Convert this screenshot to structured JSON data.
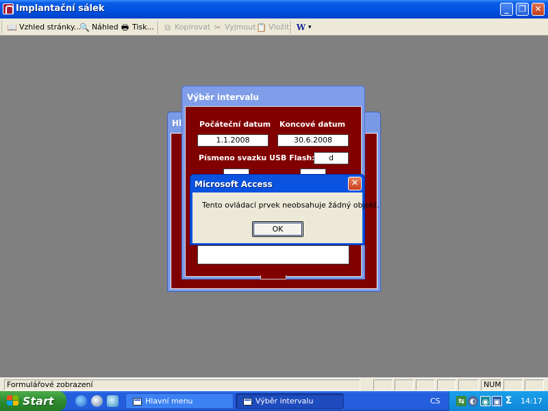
{
  "window": {
    "title": "Implantační sálek",
    "minimize": "_",
    "restore": "❐",
    "close": "✕"
  },
  "toolbar": {
    "items": [
      {
        "label": "Vzhled stránky...",
        "icon": "book-icon",
        "enabled": true
      },
      {
        "label": "Náhled",
        "icon": "preview-icon",
        "enabled": true
      },
      {
        "label": "Tisk...",
        "icon": "printer-icon",
        "enabled": true
      },
      {
        "label": "Kopírovat",
        "icon": "copy-icon",
        "enabled": false
      },
      {
        "label": "Vyjmout",
        "icon": "cut-icon",
        "enabled": false
      },
      {
        "label": "Vložit",
        "icon": "paste-icon",
        "enabled": false
      }
    ],
    "word_glyph": "W",
    "dropdown_glyph": "▾"
  },
  "background_form": {
    "title_visible": "Hl"
  },
  "interval_form": {
    "title": "Výběr intervalu",
    "start_label": "Počáteční datum",
    "end_label": "Koncové datum",
    "start_value": "1.1.2008",
    "end_value": "30.6.2008",
    "usb_label": "Písmeno svazku USB Flash:",
    "usb_value": "d"
  },
  "dialog": {
    "title": "Microsoft Access",
    "close": "✕",
    "message": "Tento ovládací prvek neobsahuje žádný objekt.",
    "ok_label": "OK"
  },
  "statusbar": {
    "text": "Formulářové zobrazení",
    "num": "NUM"
  },
  "taskbar": {
    "start_label": "Start",
    "buttons": [
      {
        "label": "Hlavní menu",
        "active": false
      },
      {
        "label": "Výběr intervalu",
        "active": true
      }
    ],
    "language": "CS",
    "clock": "14:17"
  },
  "colors": {
    "form_background": "#800000",
    "xp_blue": "#0a52e0",
    "taskbar_blue": "#245edc",
    "start_green": "#2f8b2f",
    "desktop_gray": "#808080"
  }
}
